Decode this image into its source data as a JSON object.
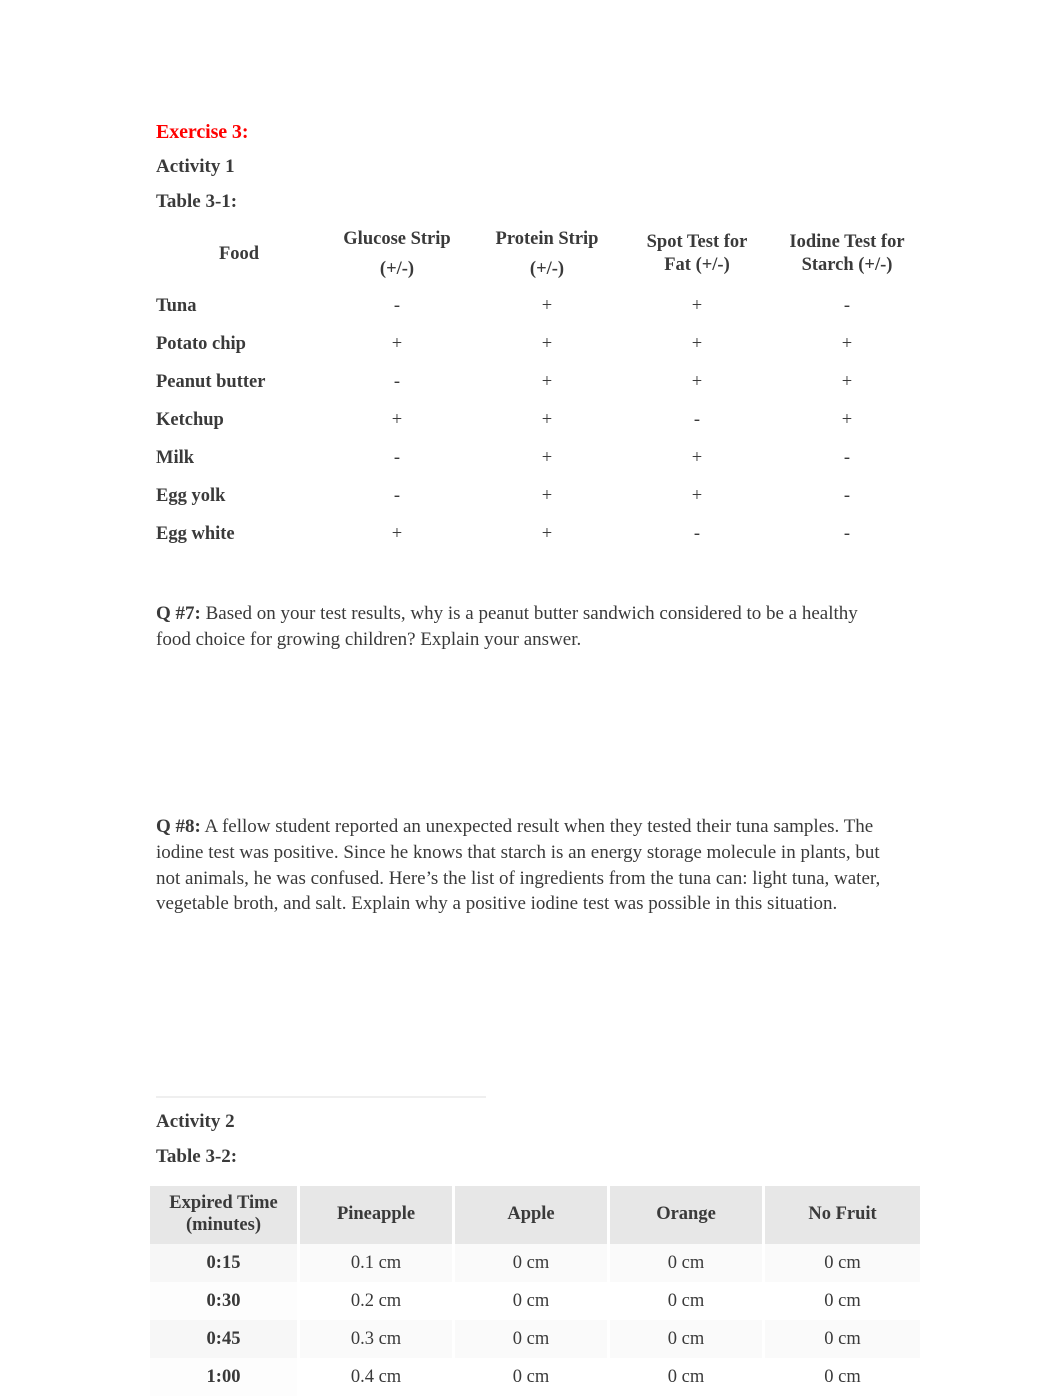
{
  "document": {
    "exercise_heading": "Exercise 3:",
    "activity1_heading": "Activity 1",
    "table31_heading": "Table 3-1:",
    "activity2_heading": "Activity 2",
    "table32_heading": "Table 3-2:"
  },
  "colors": {
    "exercise_heading": "#ff0000",
    "body_text": "#3a3a3a",
    "table32_header_bg": "#e7e7e7",
    "row_band": "#fafafa",
    "faint_rule": "#efefef"
  },
  "table31": {
    "headers": {
      "food": "Food",
      "glucose_line1": "Glucose Strip",
      "glucose_line2": "(+/-)",
      "protein_line1": "Protein Strip",
      "protein_line2": "(+/-)",
      "fat_line1": "Spot Test for",
      "fat_line2": "Fat (+/-)",
      "starch_line1": "Iodine Test for",
      "starch_line2": "Starch (+/-)"
    },
    "rows": [
      {
        "food": "Tuna",
        "glucose": "-",
        "protein": "+",
        "fat": "+",
        "starch": "-"
      },
      {
        "food": "Potato chip",
        "glucose": "+",
        "protein": "+",
        "fat": "+",
        "starch": "+"
      },
      {
        "food": "Peanut butter",
        "glucose": "-",
        "protein": "+",
        "fat": "+",
        "starch": "+"
      },
      {
        "food": "Ketchup",
        "glucose": "+",
        "protein": "+",
        "fat": "-",
        "starch": "+"
      },
      {
        "food": "Milk",
        "glucose": "-",
        "protein": "+",
        "fat": "+",
        "starch": "-"
      },
      {
        "food": "Egg yolk",
        "glucose": "-",
        "protein": "+",
        "fat": "+",
        "starch": "-"
      },
      {
        "food": "Egg white",
        "glucose": "+",
        "protein": "+",
        "fat": "-",
        "starch": "-"
      }
    ]
  },
  "questions": {
    "q7": {
      "label": "Q #7:",
      "text": " Based on your test results, why is a peanut butter sandwich considered to be a healthy food choice for growing children? Explain your answer."
    },
    "q8": {
      "label": "Q #8:",
      "text": " A fellow student reported an unexpected result when they tested their tuna samples. The iodine test was positive. Since he knows that starch is an energy storage molecule in plants, but not animals, he was confused. Here’s the list of ingredients from the tuna can: light tuna, water, vegetable broth, and salt. Explain why a positive iodine test was possible in this situation."
    }
  },
  "table32": {
    "headers": {
      "time_line1": "Expired Time",
      "time_line2": "(minutes)",
      "pineapple": "Pineapple",
      "apple": "Apple",
      "orange": "Orange",
      "no_fruit": "No Fruit"
    },
    "rows": [
      {
        "time": "0:15",
        "pineapple": "0.1 cm",
        "apple": "0 cm",
        "orange": "0 cm",
        "no_fruit": "0 cm"
      },
      {
        "time": "0:30",
        "pineapple": "0.2 cm",
        "apple": "0 cm",
        "orange": "0 cm",
        "no_fruit": "0 cm"
      },
      {
        "time": "0:45",
        "pineapple": "0.3 cm",
        "apple": "0 cm",
        "orange": "0 cm",
        "no_fruit": "0 cm"
      },
      {
        "time": "1:00",
        "pineapple": "0.4 cm",
        "apple": "0 cm",
        "orange": "0 cm",
        "no_fruit": "0 cm"
      }
    ]
  }
}
